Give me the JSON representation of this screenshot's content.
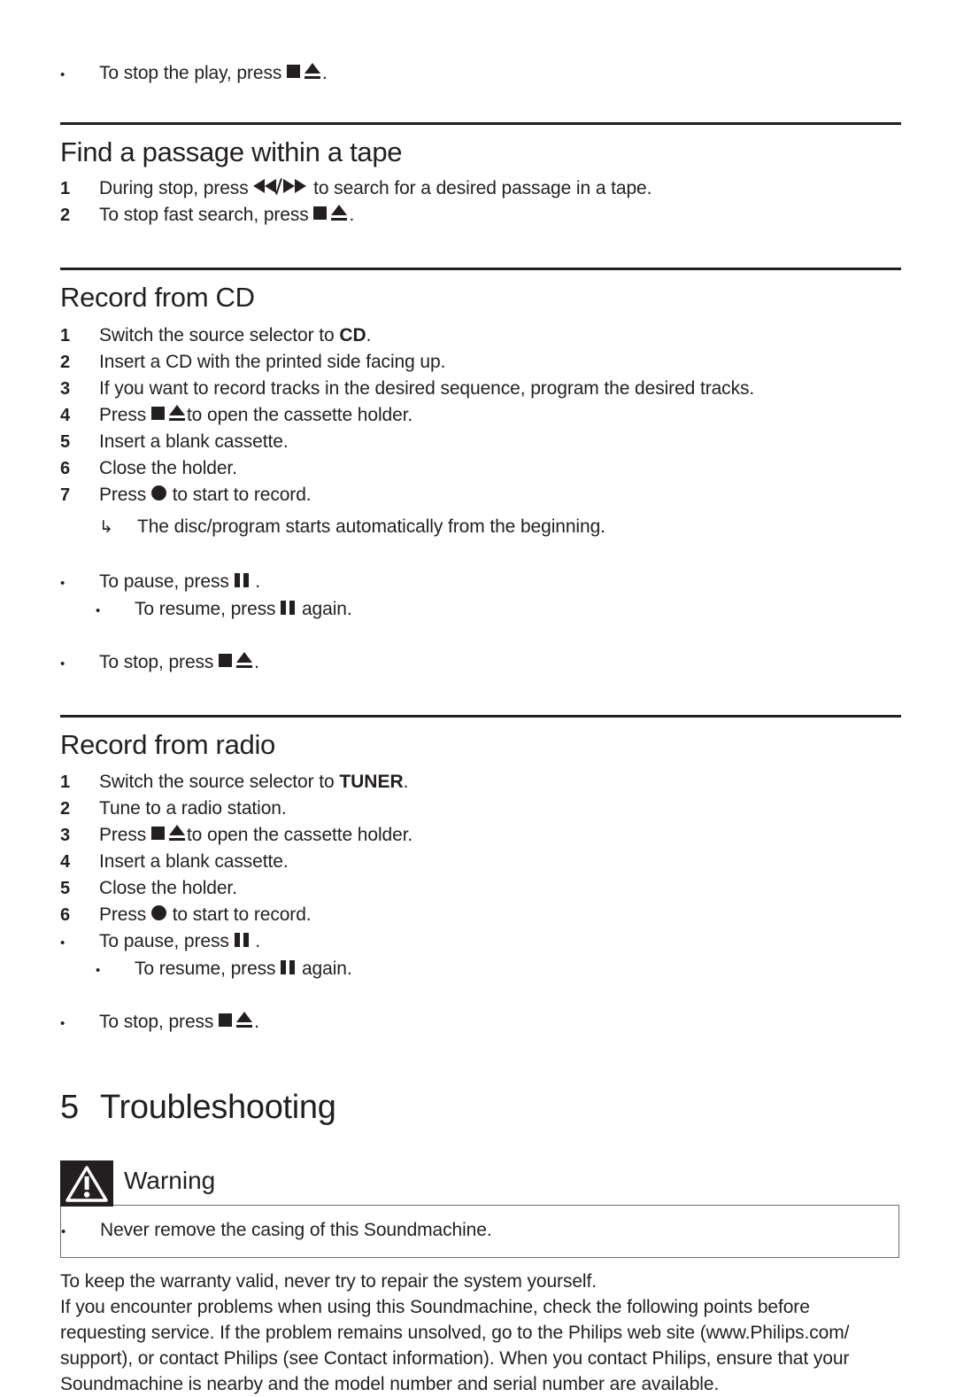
{
  "document": {
    "icons": {
      "stop_eject": "stop-eject-icon",
      "search": "rewind-forward-icon",
      "pause": "pause-icon",
      "record": "record-icon",
      "result_arrow": "result-arrow-icon",
      "warning": "warning-triangle-icon"
    },
    "colors": {
      "text": "#231f20",
      "rule": "#231f20",
      "box_border": "#6e6e6e",
      "warning_badge": "#231f20"
    }
  },
  "top_note": {
    "bullet": "•",
    "before": "To stop the play, press",
    "after": "."
  },
  "sections": [
    {
      "id": "find-passage",
      "heading": "Find a passage within a tape",
      "steps": [
        {
          "num": "1",
          "before": "During stop, press",
          "icon": "search",
          "after": "to search for a desired passage in a tape."
        },
        {
          "num": "2",
          "before": "To stop fast search, press",
          "icon": "stop_eject",
          "after": "."
        }
      ]
    },
    {
      "id": "record-from-cd",
      "heading": "Record from CD",
      "steps": [
        {
          "num": "1",
          "before": "Switch the source selector to",
          "bold": "CD",
          "after": "."
        },
        {
          "num": "2",
          "text": "Insert a CD with the printed side facing up."
        },
        {
          "num": "3",
          "text": "If you want to record tracks in the desired sequence, program the desired tracks."
        },
        {
          "num": "4",
          "before": "Press",
          "icon": "stop_eject",
          "after": "to open the cassette holder."
        },
        {
          "num": "5",
          "text": "Insert a blank cassette."
        },
        {
          "num": "6",
          "text": "Close the holder."
        },
        {
          "num": "7",
          "before": "Press",
          "icon": "record",
          "after": "to start to record."
        }
      ],
      "result": {
        "arrow": "↳",
        "text": "The disc/program starts automatically from the beginning."
      },
      "notes": [
        {
          "bullet": "•",
          "before": "To pause, press",
          "icon": "pause",
          "after": "."
        },
        {
          "bullet": "•",
          "level": 2,
          "before": "To resume, press",
          "icon": "pause",
          "after": "again."
        },
        {
          "bullet": "•",
          "before": "To stop, press",
          "icon": "stop_eject",
          "after": "."
        }
      ]
    },
    {
      "id": "record-from-radio",
      "heading": "Record from radio",
      "steps": [
        {
          "num": "1",
          "before": "Switch the source selector to",
          "bold": "TUNER",
          "after": "."
        },
        {
          "num": "2",
          "text": "Tune to a radio station."
        },
        {
          "num": "3",
          "before": "Press",
          "icon": "stop_eject",
          "after": "to open the cassette holder."
        },
        {
          "num": "4",
          "text": "Insert a blank cassette."
        },
        {
          "num": "5",
          "text": "Close the holder."
        },
        {
          "num": "6",
          "before": "Press",
          "icon": "record",
          "after": "to start to record."
        }
      ],
      "notes": [
        {
          "bullet": "•",
          "before": "To pause, press",
          "icon": "pause",
          "after": "."
        },
        {
          "bullet": "•",
          "level": 2,
          "before": "To resume, press",
          "icon": "pause",
          "after": "again."
        },
        {
          "bullet": "•",
          "before": "To stop, press",
          "icon": "stop_eject",
          "after": "."
        }
      ]
    }
  ],
  "chapter": {
    "number": "5",
    "title": "Troubleshooting"
  },
  "warning": {
    "label": "Warning",
    "bullet": "•",
    "item": "Never remove the casing of this Soundmachine."
  },
  "closing": {
    "line1": "To keep the warranty valid, never try to repair the system yourself.",
    "paragraph_lines": [
      "If you encounter problems when using this Soundmachine, check the following points before",
      "requesting service. If the problem remains unsolved, go to the Philips web site (www.Philips.com/",
      "support), or contact Philips (see Contact information). When you contact Philips, ensure that your",
      "Soundmachine is nearby and the model number and serial number are available."
    ]
  }
}
